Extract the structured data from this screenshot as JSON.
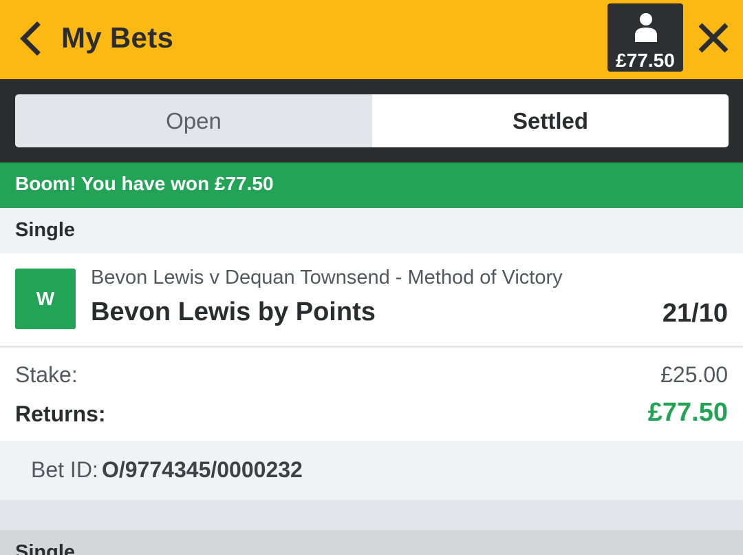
{
  "header": {
    "title": "My Bets",
    "balance": "£77.50",
    "icons": {
      "back": "chevron-left-icon",
      "user": "user-icon",
      "close": "close-icon"
    }
  },
  "tabs": [
    {
      "label": "Open",
      "active": false
    },
    {
      "label": "Settled",
      "active": true
    }
  ],
  "banner": {
    "text": "Boom! You have won £77.50"
  },
  "bets": [
    {
      "type": "Single",
      "result": "W",
      "market": "Bevon Lewis v Dequan Townsend - Method of Victory",
      "selection": "Bevon Lewis by Points",
      "odds": "21/10",
      "stake_label": "Stake:",
      "stake": "£25.00",
      "returns_label": "Returns:",
      "returns": "£77.50",
      "bet_id_label": "Bet ID:",
      "bet_id": "O/9774345/0000232"
    },
    {
      "type": "Single"
    }
  ],
  "colors": {
    "brand": "#fdb913",
    "dark": "#2b2c2e",
    "win": "#22a356"
  }
}
